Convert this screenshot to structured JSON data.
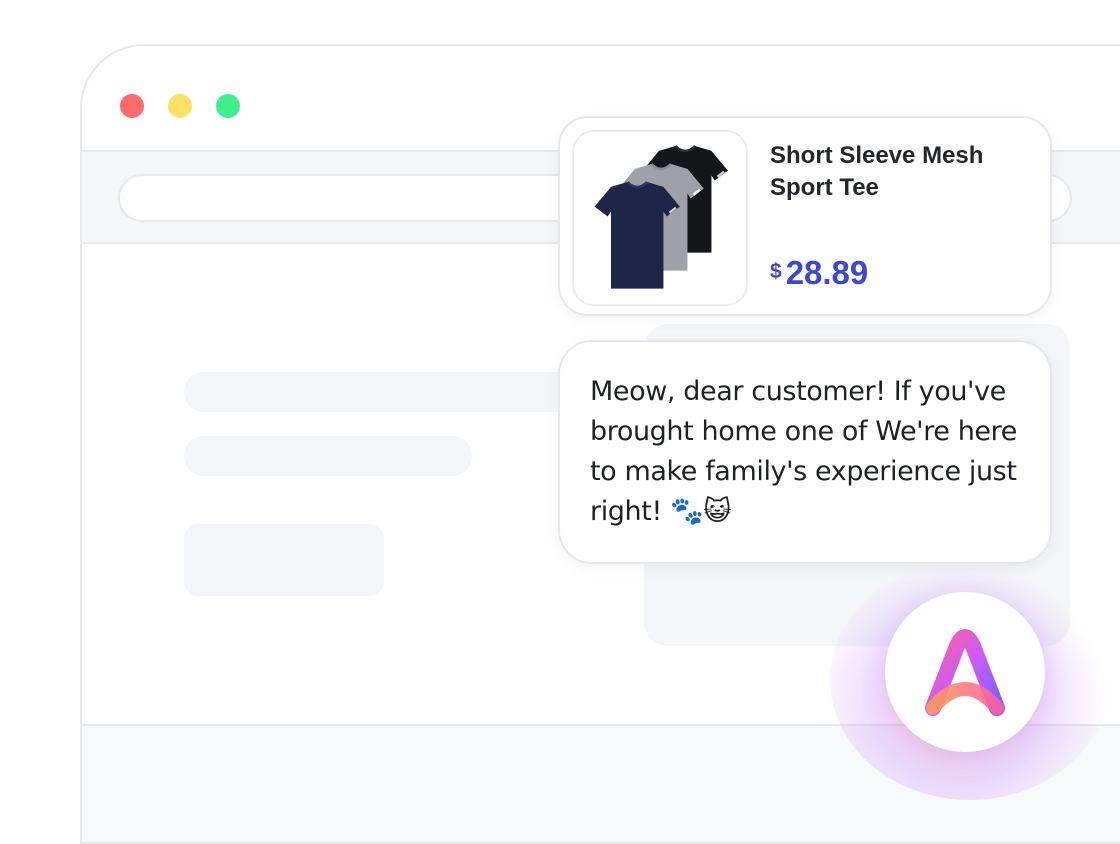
{
  "window": {
    "controls": [
      "close",
      "minimize",
      "maximize"
    ]
  },
  "product": {
    "title": "Short Sleeve Mesh Sport Tee",
    "currency": "$",
    "price": "28.89",
    "image_icon": "tshirt-stack-image",
    "shirt_colors": [
      "#1f2547",
      "#9ea2a8",
      "#15161a"
    ]
  },
  "chat": {
    "message": "Meow, dear customer! If you've brought home one of We're here to make family's experience just right! 🐾😺"
  },
  "assistant": {
    "icon": "brand-a-logo-icon",
    "accent_colors": [
      "#ff5fa2",
      "#a35cff",
      "#ff9a5a"
    ]
  },
  "colors": {
    "price": "#3b47d8",
    "close": "#ff6b6b",
    "minimize": "#ffe066",
    "maximize": "#3ef08a"
  }
}
